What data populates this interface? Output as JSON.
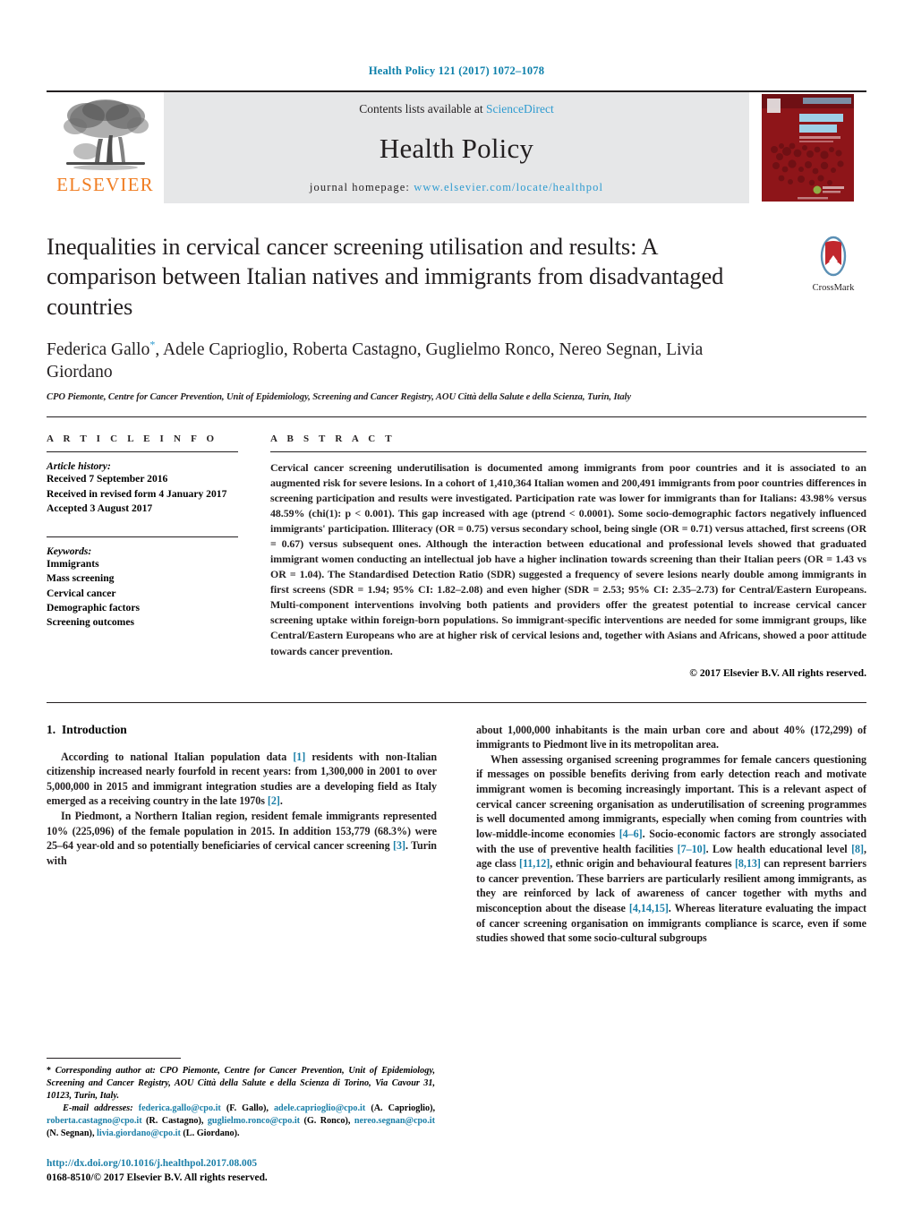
{
  "running_head": "Health Policy 121 (2017) 1072–1078",
  "masthead": {
    "publisher_name": "ELSEVIER",
    "contents_prefix": "Contents lists available at",
    "contents_link": "ScienceDirect",
    "journal_name": "Health Policy",
    "homepage_prefix": "journal homepage:",
    "homepage_url": "www.elsevier.com/locate/healthpol",
    "cover_title_line1": "HEALTH",
    "cover_title_line2": "POLICY",
    "cover_color": "#8e1519",
    "cover_title_color": "#9ecfe6",
    "link_color": "#2e9bd0",
    "elsevier_orange": "#f07d22"
  },
  "article": {
    "title": "Inequalities in cervical cancer screening utilisation and results: A comparison between Italian natives and immigrants from disadvantaged countries",
    "authors": "Federica Gallo, Adele Caprioglio, Roberta Castagno, Guglielmo Ronco, Nereo Segnan, Livia Giordano",
    "author_marker": "*",
    "affiliation": "CPO Piemonte, Centre for Cancer Prevention, Unit of Epidemiology, Screening and Cancer Registry, AOU Città della Salute e della Scienza, Turin, Italy",
    "crossmark_label": "CrossMark"
  },
  "info": {
    "heading": "A R T I C L E   I N F O",
    "history_title": "Article history:",
    "history": [
      "Received 7 September 2016",
      "Received in revised form 4 January 2017",
      "Accepted 3 August 2017"
    ],
    "keywords_title": "Keywords:",
    "keywords": [
      "Immigrants",
      "Mass screening",
      "Cervical cancer",
      "Demographic factors",
      "Screening outcomes"
    ]
  },
  "abstract": {
    "heading": "A B S T R A C T",
    "text": "Cervical cancer screening underutilisation is documented among immigrants from poor countries and it is associated to an augmented risk for severe lesions. In a cohort of 1,410,364 Italian women and 200,491 immigrants from poor countries differences in screening participation and results were investigated. Participation rate was lower for immigrants than for Italians: 43.98% versus 48.59% (chi(1): p < 0.001). This gap increased with age (ptrend < 0.0001). Some socio-demographic factors negatively influenced immigrants' participation. Illiteracy (OR = 0.75) versus secondary school, being single (OR = 0.71) versus attached, first screens (OR = 0.67) versus subsequent ones. Although the interaction between educational and professional levels showed that graduated immigrant women conducting an intellectual job have a higher inclination towards screening than their Italian peers (OR = 1.43 vs OR = 1.04). The Standardised Detection Ratio (SDR) suggested a frequency of severe lesions nearly double among immigrants in first screens (SDR = 1.94; 95% CI: 1.82–2.08) and even higher (SDR = 2.53; 95% CI: 2.35–2.73) for Central/Eastern Europeans. Multi-component interventions involving both patients and providers offer the greatest potential to increase cervical cancer screening uptake within foreign-born populations. So immigrant-specific interventions are needed for some immigrant groups, like Central/Eastern Europeans who are at higher risk of cervical lesions and, together with Asians and Africans, showed a poor attitude towards cancer prevention.",
    "copyright": "© 2017 Elsevier B.V. All rights reserved."
  },
  "introduction": {
    "number": "1.",
    "heading": "Introduction",
    "left_paragraphs": [
      "According to national Italian population data [1] residents with non-Italian citizenship increased nearly fourfold in recent years: from 1,300,000 in 2001 to over 5,000,000 in 2015 and immigrant integration studies are a developing field as Italy emerged as a receiving country in the late 1970s [2].",
      "In Piedmont, a Northern Italian region, resident female immigrants represented 10% (225,096) of the female population in 2015. In addition 153,779 (68.3%) were 25–64 year-old and so potentially beneficiaries of cervical cancer screening [3]. Turin with"
    ],
    "right_paragraphs": [
      "about 1,000,000 inhabitants is the main urban core and about 40% (172,299) of immigrants to Piedmont live in its metropolitan area.",
      "When assessing organised screening programmes for female cancers questioning if messages on possible benefits deriving from early detection reach and motivate immigrant women is becoming increasingly important. This is a relevant aspect of cervical cancer screening organisation as underutilisation of screening programmes is well documented among immigrants, especially when coming from countries with low-middle-income economies [4–6]. Socio-economic factors are strongly associated with the use of preventive health facilities [7–10]. Low health educational level [8], age class [11,12], ethnic origin and behavioural features [8,13] can represent barriers to cancer prevention. These barriers are particularly resilient among immigrants, as they are reinforced by lack of awareness of cancer together with myths and misconception about the disease [4,14,15]. Whereas literature evaluating the impact of cancer screening organisation on immigrants compliance is scarce, even if some studies showed that some socio-cultural subgroups"
    ]
  },
  "footnote": {
    "corresponding": "Corresponding author at: CPO Piemonte, Centre for Cancer Prevention, Unit of Epidemiology, Screening and Cancer Registry, AOU Città della Salute e della Scienza di Torino, Via Cavour 31, 10123, Turin, Italy.",
    "email_label": "E-mail addresses:",
    "emails": [
      {
        "address": "federica.gallo@cpo.it",
        "name": "(F. Gallo),"
      },
      {
        "address": "adele.caprioglio@cpo.it",
        "name": "(A. Caprioglio),"
      },
      {
        "address": "roberta.castagno@cpo.it",
        "name": "(R. Castagno),"
      },
      {
        "address": "guglielmo.ronco@cpo.it",
        "name": "(G. Ronco),"
      },
      {
        "address": "nereo.segnan@cpo.it",
        "name": "(N. Segnan),"
      },
      {
        "address": "livia.giordano@cpo.it",
        "name": "(L. Giordano)."
      }
    ]
  },
  "footer": {
    "doi": "http://dx.doi.org/10.1016/j.healthpol.2017.08.005",
    "issn_line": "0168-8510/© 2017 Elsevier B.V. All rights reserved."
  }
}
